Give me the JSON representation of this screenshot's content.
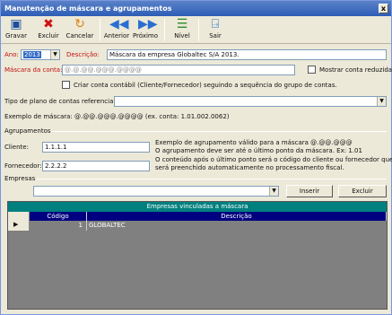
{
  "window": {
    "title": "Manutenção de máscara e agrupamentos",
    "close_label": "x"
  },
  "toolbar": {
    "gravar": "Gravar",
    "excluir": "Excluir",
    "cancelar": "Cancelar",
    "anterior": "Anterior",
    "proximo": "Próximo",
    "nivel": "Nível",
    "sair": "Sair"
  },
  "form": {
    "ano_label": "Ano:",
    "ano_value": "2013",
    "descricao_label": "Descrição:",
    "descricao_value": "Máscara da empresa Globaltec S/A 2013.",
    "mascara_label": "Máscara da conta:",
    "mascara_value": "@.@.@@.@@@.@@@@",
    "mostrar_reduzida": "Mostrar conta reduzida",
    "criar_conta": "Criar conta contábil (Cliente/Fornecedor) seguindo a sequência do grupo de contas.",
    "tipo_plano_label": "Tipo de plano de contas referencial:",
    "exemplo_mascara": "Exemplo de máscara: @.@@.@@@.@@@@  (ex. conta: 1.01.002.0062)"
  },
  "agrupamentos": {
    "title": "Agrupamentos",
    "cliente_label": "Cliente:",
    "cliente_value": "1.1.1.1",
    "fornecedor_label": "Fornecedor:",
    "fornecedor_value": "2.2.2.2",
    "help1": "Exemplo de agrupamento válido para a máscara @.@@.@@@",
    "help2": "O agrupamento deve ser até o último ponto da máscara. Ex: 1.01",
    "help3": "O conteúdo após o último ponto será o código do cliente ou fornecedor que",
    "help4": "será preenchido automaticamente no processamento fiscal."
  },
  "empresas": {
    "title": "Empresas",
    "inserir": "Inserir",
    "excluir": "Excluir",
    "grid_title": "Empresas vinculadas a máscara",
    "columns": [
      "Código",
      "Descrição"
    ],
    "rows": [
      {
        "codigo": "1",
        "descricao": "GLOBALTEC"
      }
    ]
  },
  "colors": {
    "titlebar": "#2d5db7",
    "grid_header": "#00807f",
    "col_header": "#000080",
    "required_label": "#c01010"
  },
  "icons": {
    "gravar": "floppy-disk-icon",
    "excluir": "red-x-icon",
    "cancelar": "cancel-arrows-icon",
    "anterior": "double-left-arrow-icon",
    "proximo": "double-right-arrow-icon",
    "nivel": "tree-level-icon",
    "sair": "exit-door-icon"
  }
}
